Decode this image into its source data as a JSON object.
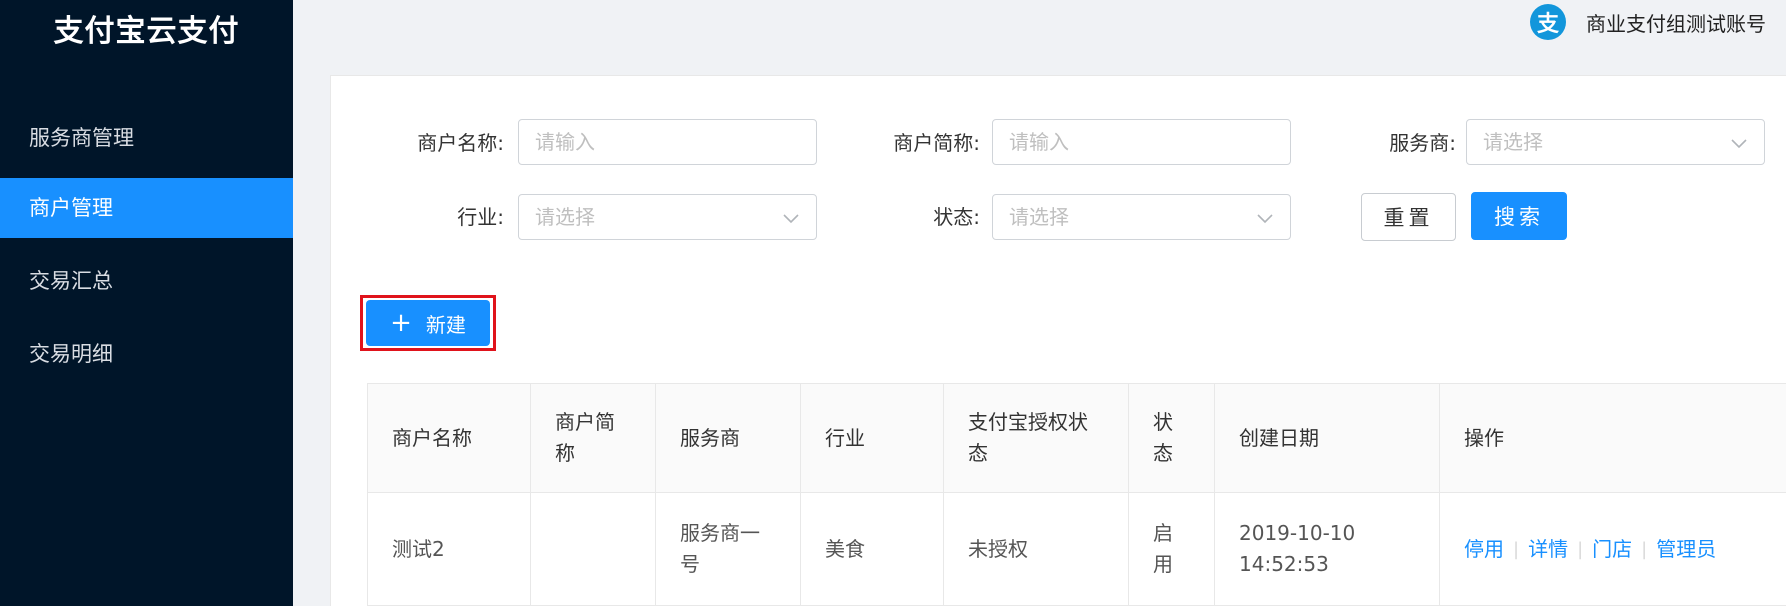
{
  "app": {
    "logo": "支付宝云支付",
    "account_name": "商业支付组测试账号",
    "account_icon_glyph": "支"
  },
  "sidebar": {
    "items": [
      {
        "label": "服务商管理",
        "active": false
      },
      {
        "label": "商户管理",
        "active": true
      },
      {
        "label": "交易汇总",
        "active": false
      },
      {
        "label": "交易明细",
        "active": false
      }
    ]
  },
  "filters": {
    "merchant_name_label": "商户名称:",
    "merchant_name_placeholder": "请输入",
    "merchant_short_label": "商户简称:",
    "merchant_short_placeholder": "请输入",
    "provider_label": "服务商:",
    "provider_placeholder": "请选择",
    "industry_label": "行业:",
    "industry_placeholder": "请选择",
    "status_label": "状态:",
    "status_placeholder": "请选择",
    "reset_label": "重置",
    "search_label": "搜索"
  },
  "actions": {
    "new_icon": "+",
    "new_label": "新建"
  },
  "table": {
    "headers": [
      "商户名称",
      "商户简称",
      "服务商",
      "行业",
      "支付宝授权状态",
      "状态",
      "创建日期",
      "操作"
    ],
    "rows": [
      {
        "name": "测试2",
        "short": "",
        "provider": "服务商一号",
        "industry": "美食",
        "auth": "未授权",
        "status": "启用",
        "created": "2019-10-10 14:52:53",
        "ops": [
          "停用",
          "详情",
          "门店",
          "管理员"
        ]
      }
    ]
  },
  "colors": {
    "sidebar_bg": "#001529",
    "primary": "#1890ff",
    "highlight_border": "#e0131b"
  }
}
